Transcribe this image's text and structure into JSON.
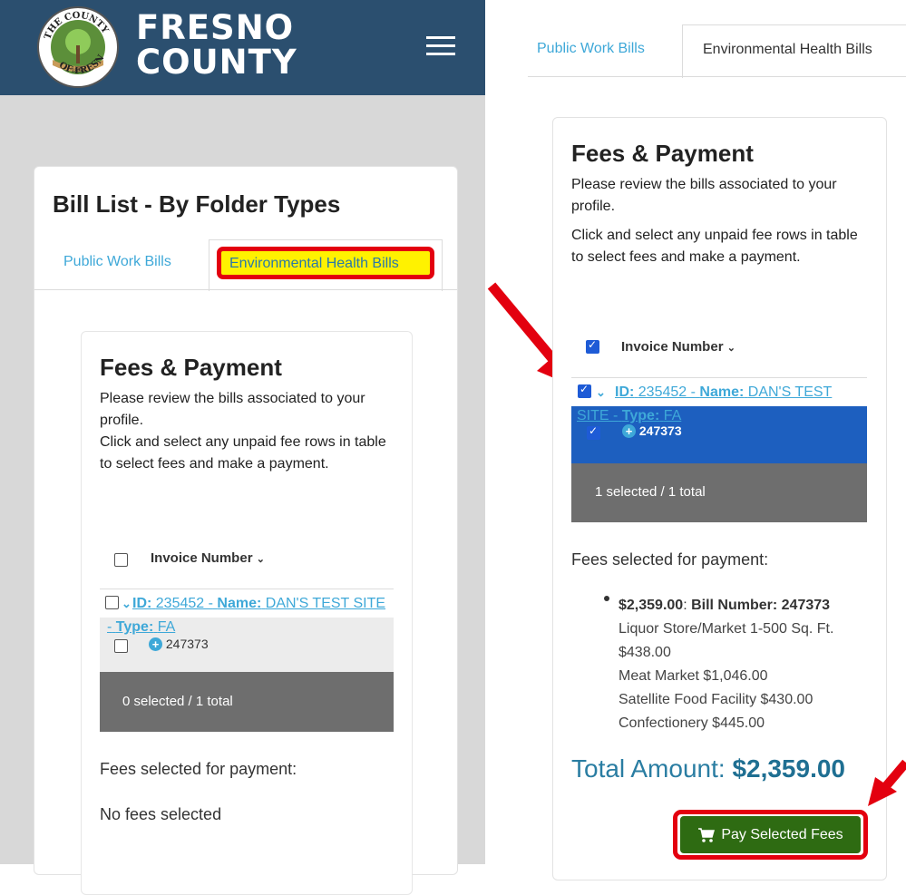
{
  "header": {
    "county_line1": "FRESNO",
    "county_line2": "COUNTY",
    "seal_text_top": "THE COUNTY",
    "seal_text_bottom": "OF FRESNO",
    "seal_year": "1856"
  },
  "left_card": {
    "title": "Bill List - By Folder Types",
    "tab_public_work": "Public Work Bills",
    "tab_environmental": "Environmental Health Bills",
    "fees_title": "Fees & Payment",
    "desc1": "Please review the bills associated to your profile.",
    "desc2": "Click and select any unpaid fee rows in table to select fees and make a payment.",
    "invoice_header": "Invoice Number",
    "link_id_label": "ID:",
    "link_id_value": "235452 -",
    "link_name_label": "Name:",
    "link_name_value": "DAN'S TEST SITE -",
    "link_type_label": "Type:",
    "link_type_value": "FA",
    "bill_number": "247373",
    "selected_text": "0 selected / 1 total",
    "fees_for_payment": "Fees selected for payment:",
    "no_fees": "No fees selected"
  },
  "right": {
    "tab_public_work": "Public Work Bills",
    "tab_environmental": "Environmental Health Bills",
    "fees_title": "Fees & Payment",
    "desc1": "Please review the bills associated to your profile.",
    "desc2": "Click and select any unpaid fee rows in table to select fees and make a payment.",
    "invoice_header": "Invoice Number",
    "link_id_label": "ID:",
    "link_id_value": "235452 -",
    "link_name_label": "Name:",
    "link_name_value": "DAN'S TEST SITE -",
    "link_type_label": "Type:",
    "link_type_value": "FA",
    "bill_number": "247373",
    "selected_text": "1 selected / 1 total",
    "fees_for_payment": "Fees selected for payment:",
    "bullet_amount": "$2,359.00",
    "bullet_bill_label": "Bill Number: 247373",
    "fee_lines": [
      "Liquor Store/Market 1-500 Sq. Ft. $438.00",
      "Meat Market $1,046.00",
      "Satellite Food Facility $430.00",
      "Confectionery $445.00"
    ],
    "total_label": "Total Amount:",
    "total_value": "$2,359.00",
    "pay_button": "Pay Selected Fees"
  },
  "colors": {
    "header_bg": "#2b4f6f",
    "link": "#3ea8d8",
    "highlight_yellow": "#fff200",
    "annotation_red": "#e3000f",
    "selected_row": "#1d5fbf",
    "pay_button": "#2e6b12"
  }
}
